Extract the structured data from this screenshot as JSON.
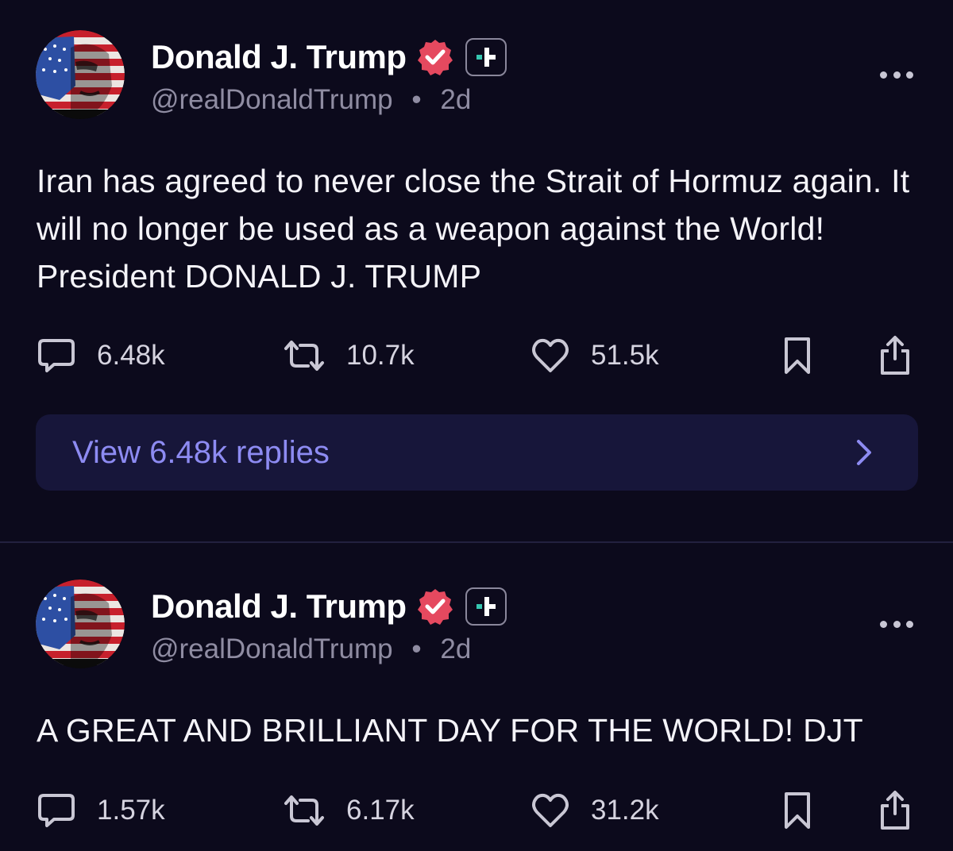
{
  "colors": {
    "background": "#0c0a1c",
    "verified_badge": "#e5495f",
    "accent_link": "#8d8bf2",
    "muted_text": "#8f8ca2"
  },
  "posts": [
    {
      "author": {
        "display_name": "Donald J. Trump",
        "handle": "@realDonaldTrump",
        "separator": "•",
        "age": "2d",
        "verified_icon": "verified-badge-icon",
        "plus_icon": "plus-icon"
      },
      "text": "Iran has agreed to never close the Strait of Hormuz again. It will no longer be used as a weapon against the World! President DONALD J. TRUMP",
      "stats": {
        "replies": "6.48k",
        "reposts": "10.7k",
        "likes": "51.5k"
      },
      "replies_link": "View 6.48k replies"
    },
    {
      "author": {
        "display_name": "Donald J. Trump",
        "handle": "@realDonaldTrump",
        "separator": "•",
        "age": "2d",
        "verified_icon": "verified-badge-icon",
        "plus_icon": "plus-icon"
      },
      "text": "A GREAT AND BRILLIANT DAY FOR THE WORLD! DJT",
      "stats": {
        "replies": "1.57k",
        "reposts": "6.17k",
        "likes": "31.2k"
      }
    }
  ]
}
